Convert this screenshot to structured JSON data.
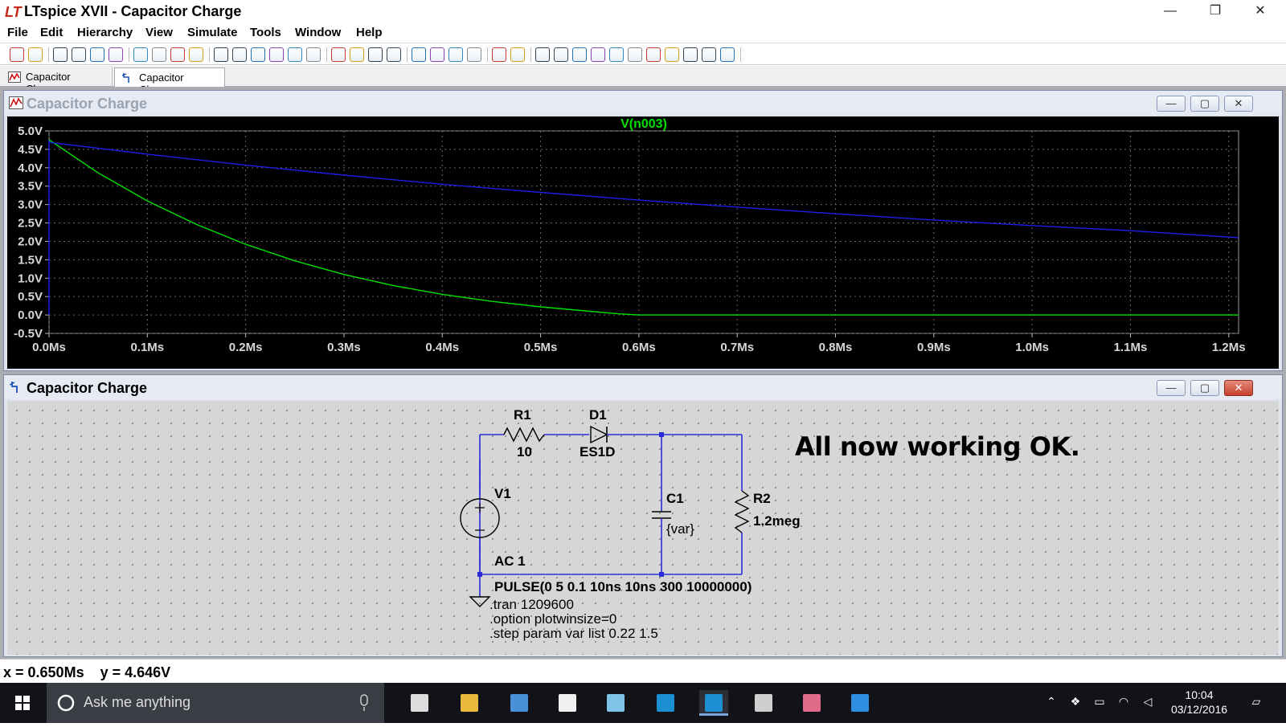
{
  "window": {
    "title": "LTspice XVII - Capacitor Charge",
    "logo_glyph": "LT",
    "minimize": "—",
    "maximize": "❐",
    "close": "✕"
  },
  "menu": [
    "File",
    "Edit",
    "Hierarchy",
    "View",
    "Simulate",
    "Tools",
    "Window",
    "Help"
  ],
  "toolbar_icons": [
    "new-schematic-icon",
    "open-icon",
    "save-icon",
    "control-panel-icon",
    "run-icon",
    "halt-icon",
    "zoom-in-icon",
    "zoom-pan-icon",
    "zoom-out-icon",
    "zoom-fit-icon",
    "autorange-icon",
    "grid-icon",
    "tile-horizontal-icon",
    "cascade-icon",
    "tile-vertical-icon",
    "cut-icon",
    "copy-icon",
    "paste-icon",
    "find-icon",
    "print-setup-icon",
    "print-icon",
    "draw-wire-icon",
    "ground-icon",
    "label-net-icon",
    "resistor-icon",
    "capacitor-icon",
    "inductor-icon",
    "diode-icon",
    "component-icon",
    "move-icon",
    "drag-icon",
    "undo-icon",
    "redo-icon",
    "rotate-icon",
    "mirror-icon",
    "text-icon",
    "spice-directive-icon"
  ],
  "tabs": [
    {
      "label": "Capacitor Charge",
      "icon": "waveform-icon"
    },
    {
      "label": "Capacitor Charge",
      "icon": "schematic-icon"
    }
  ],
  "plot_window": {
    "title": "Capacitor Charge",
    "trace_label": "V(n003)"
  },
  "schematic_window": {
    "title": "Capacitor Charge"
  },
  "chart_data": {
    "type": "line",
    "title": "V(n003)",
    "xlabel": "",
    "ylabel": "",
    "x_ticks": [
      "0.0Ms",
      "0.1Ms",
      "0.2Ms",
      "0.3Ms",
      "0.4Ms",
      "0.5Ms",
      "0.6Ms",
      "0.7Ms",
      "0.8Ms",
      "0.9Ms",
      "1.0Ms",
      "1.1Ms",
      "1.2Ms"
    ],
    "y_ticks": [
      "5.0V",
      "4.5V",
      "4.0V",
      "3.5V",
      "3.0V",
      "2.5V",
      "2.0V",
      "1.5V",
      "1.0V",
      "0.5V",
      "0.0V",
      "-0.5V"
    ],
    "xlim": [
      0,
      1.21
    ],
    "ylim": [
      -0.5,
      5.0
    ],
    "grid": true,
    "series": [
      {
        "color": "#00e000",
        "x": [
          0,
          0.05,
          0.1,
          0.15,
          0.2,
          0.25,
          0.3,
          0.35,
          0.4,
          0.45,
          0.5,
          0.55,
          0.58,
          0.6,
          0.7,
          0.8,
          0.9,
          1.0,
          1.1,
          1.21
        ],
        "y": [
          4.76,
          3.86,
          3.1,
          2.46,
          1.92,
          1.47,
          1.1,
          0.8,
          0.56,
          0.37,
          0.22,
          0.1,
          0.03,
          0.0,
          0.0,
          0.0,
          0.0,
          0.0,
          0.0,
          0.0
        ]
      },
      {
        "color": "#1e1ee6",
        "x": [
          0,
          0.1,
          0.2,
          0.3,
          0.4,
          0.5,
          0.6,
          0.7,
          0.8,
          0.9,
          1.0,
          1.1,
          1.21
        ],
        "y": [
          4.69,
          4.37,
          4.07,
          3.8,
          3.55,
          3.33,
          3.12,
          2.93,
          2.75,
          2.58,
          2.43,
          2.29,
          2.1
        ]
      }
    ]
  },
  "schematic": {
    "components": {
      "r1_name": "R1",
      "r1_value": "10",
      "d1_name": "D1",
      "d1_value": "ES1D",
      "v1_name": "V1",
      "v1_ac": "AC 1",
      "c1_name": "C1",
      "c1_value": "{var}",
      "r2_name": "R2",
      "r2_value": "1.2meg"
    },
    "comment": "All now working OK.",
    "directives": [
      "PULSE(0 5 0.1 10ns 10ns 300 10000000)",
      ".tran 1209600",
      ".option plotwinsize=0",
      ".step param var list 0.22 1.5"
    ]
  },
  "status": {
    "text": "x = 0.650Ms    y = 4.646V"
  },
  "taskbar": {
    "search_placeholder": "Ask me anything",
    "time": "10:04",
    "date": "03/12/2016",
    "apps": [
      "task-view-icon",
      "file-explorer-icon",
      "library-icon",
      "document-icon",
      "notepad-icon",
      "ltspice-iv-icon",
      "ltspice-xvii-icon",
      "calculator-icon",
      "paint-icon",
      "edge-icon"
    ]
  }
}
